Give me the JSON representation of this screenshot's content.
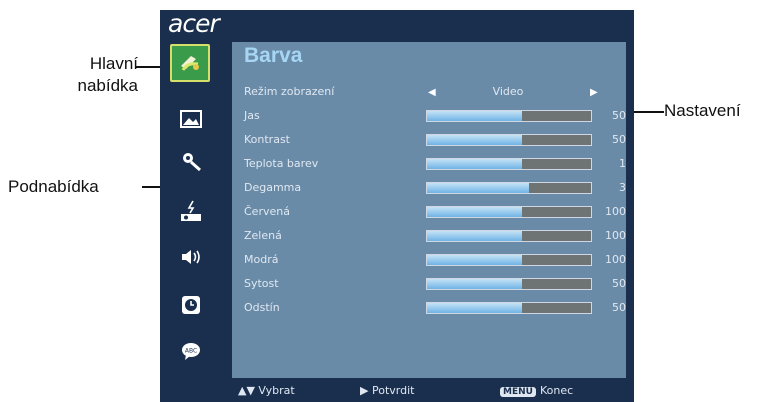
{
  "callouts": {
    "main_menu_line1": "Hlavní",
    "main_menu_line2": "nabídka",
    "submenu": "Podnabídka",
    "settings": "Nastavení"
  },
  "brand": {
    "logo": "acer"
  },
  "main_menu": {
    "items": [
      {
        "icon": "color-icon",
        "selected": true
      },
      {
        "icon": "image-icon"
      },
      {
        "icon": "settings-icon"
      },
      {
        "icon": "management-icon"
      },
      {
        "icon": "audio-icon"
      },
      {
        "icon": "timer-icon"
      },
      {
        "icon": "language-icon"
      }
    ]
  },
  "submenu": {
    "title": "Barva",
    "mode": {
      "label": "Režim zobrazení",
      "value": "Video"
    },
    "rows": [
      {
        "label": "Jas",
        "value": "50",
        "level": 0.58
      },
      {
        "label": "Kontrast",
        "value": "50",
        "level": 0.58
      },
      {
        "label": "Teplota barev",
        "value": "1",
        "level": 0.58
      },
      {
        "label": "Degamma",
        "value": "3",
        "level": 0.62
      },
      {
        "label": "Červená",
        "value": "100",
        "level": 0.58
      },
      {
        "label": "Zelená",
        "value": "100",
        "level": 0.58
      },
      {
        "label": "Modrá",
        "value": "100",
        "level": 0.58
      },
      {
        "label": "Sytost",
        "value": "50",
        "level": 0.58
      },
      {
        "label": "Odstín",
        "value": "50",
        "level": 0.58
      }
    ]
  },
  "footer": {
    "select": "Vybrat",
    "confirm": "Potvrdit",
    "menu_key": "MENU",
    "exit": "Konec"
  },
  "colors": {
    "osd_background": "#1a2f4e",
    "panel_background": "#6a8ba8",
    "title": "#a6d6f4",
    "slider_fill": "#8ec6ee",
    "selected_icon": "#3a9b4a"
  }
}
